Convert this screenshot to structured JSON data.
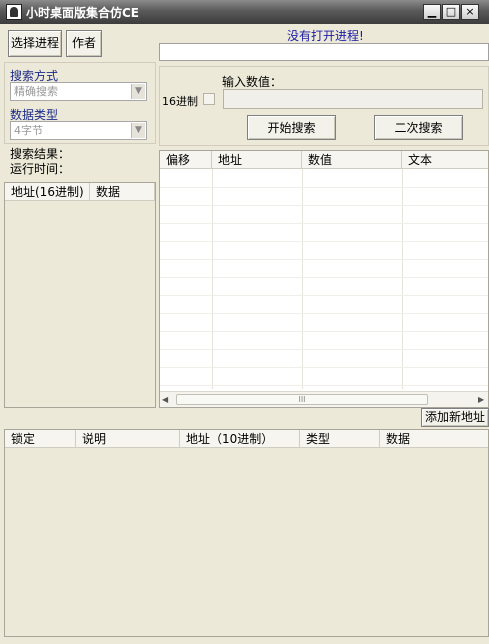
{
  "window": {
    "title": "小时桌面版集合仿CE",
    "controls": [
      "minimize-icon",
      "maximize-icon",
      "close-icon"
    ],
    "control_glyphs": [
      "▁",
      "□",
      "×"
    ]
  },
  "toolbar": {
    "select_process": "选择进程",
    "author": "作者",
    "status": "没有打开进程!"
  },
  "search_panel": {
    "method_label": "搜索方式",
    "method_value": "精确搜索",
    "type_label": "数据类型",
    "type_value": "4字节",
    "result_label": "搜索结果：",
    "time_label": "运行时间："
  },
  "value_panel": {
    "hex_label": "16进制",
    "input_label": "输入数值：",
    "input_value": "",
    "start_search": "开始搜索",
    "second_search": "二次搜索"
  },
  "results_list": {
    "columns": [
      "地址(16进制)",
      "数据"
    ]
  },
  "memory_table": {
    "columns": [
      "偏移",
      "地址",
      "数值",
      "文本"
    ],
    "scroll_grip": "III"
  },
  "address_list": {
    "add_button": "添加新地址",
    "columns": [
      "锁定",
      "说明",
      "地址（10进制）",
      "类型",
      "数据"
    ]
  },
  "colors": {
    "title_gradient_top": "#8c8c8c",
    "window_bg": "#ece9d8",
    "label_blue": "#1a2a8a",
    "status_blue": "#1a1aa8"
  }
}
